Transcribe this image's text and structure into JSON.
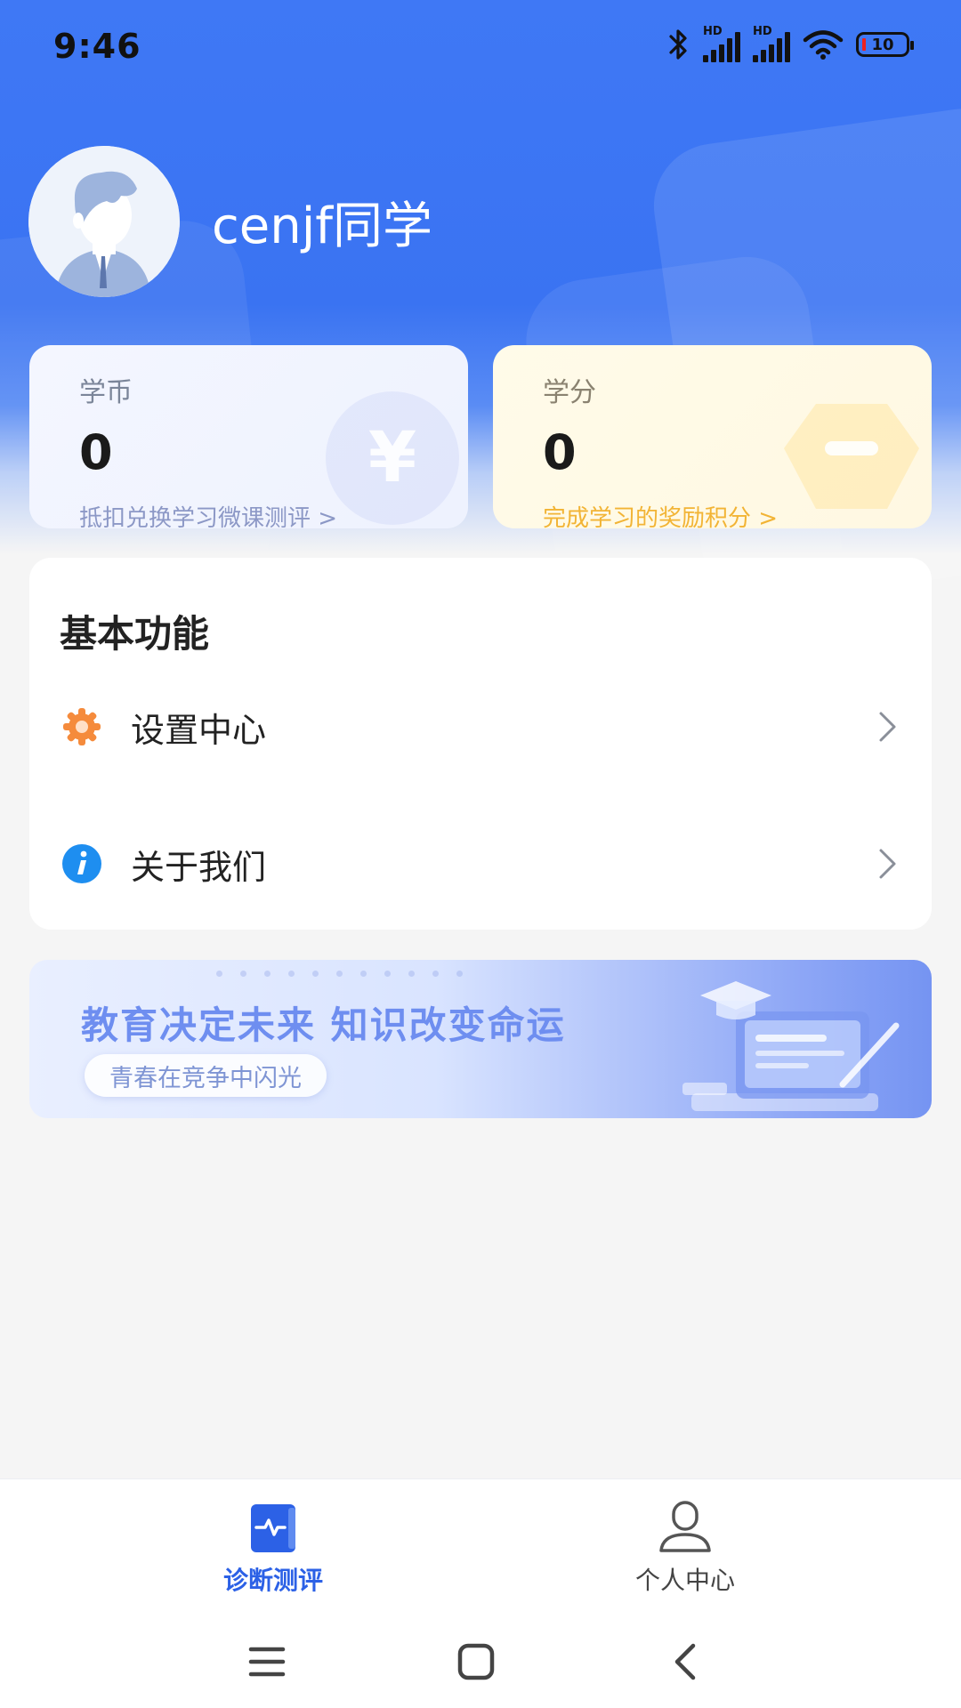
{
  "status_bar": {
    "time": "9:46",
    "signal_label": "HD",
    "battery_level": "10",
    "icons": [
      "bluetooth-icon",
      "signal-icon",
      "signal-icon",
      "wifi-icon",
      "battery-icon"
    ]
  },
  "profile": {
    "username": "cenjf同学",
    "avatar_icon": "avatar-icon"
  },
  "stats": {
    "coin": {
      "label": "学币",
      "value": "0",
      "link": "抵扣兑换学习微课测评 >",
      "icon": "yen-coin-icon"
    },
    "credit": {
      "label": "学分",
      "value": "0",
      "link": "完成学习的奖励积分 >",
      "icon": "gem-icon"
    }
  },
  "functions": {
    "title": "基本功能",
    "items": [
      {
        "label": "设置中心",
        "icon": "gear-icon"
      },
      {
        "label": "关于我们",
        "icon": "info-icon"
      }
    ]
  },
  "banner": {
    "title": "教育决定未来  知识改变命运",
    "subtitle": "青春在竞争中闪光"
  },
  "tabbar": {
    "tabs": [
      {
        "label": "诊断测评",
        "icon": "diagnosis-icon",
        "active": true
      },
      {
        "label": "个人中心",
        "icon": "person-icon",
        "active": false
      }
    ]
  },
  "nav": {
    "buttons": [
      "menu-icon",
      "home-icon",
      "back-icon"
    ]
  },
  "colors": {
    "primary": "#3a73f2",
    "tab_active": "#2c61e6",
    "credit_link": "#f2b435",
    "gear_orange": "#f58b3c",
    "info_blue": "#1e8ef0"
  }
}
